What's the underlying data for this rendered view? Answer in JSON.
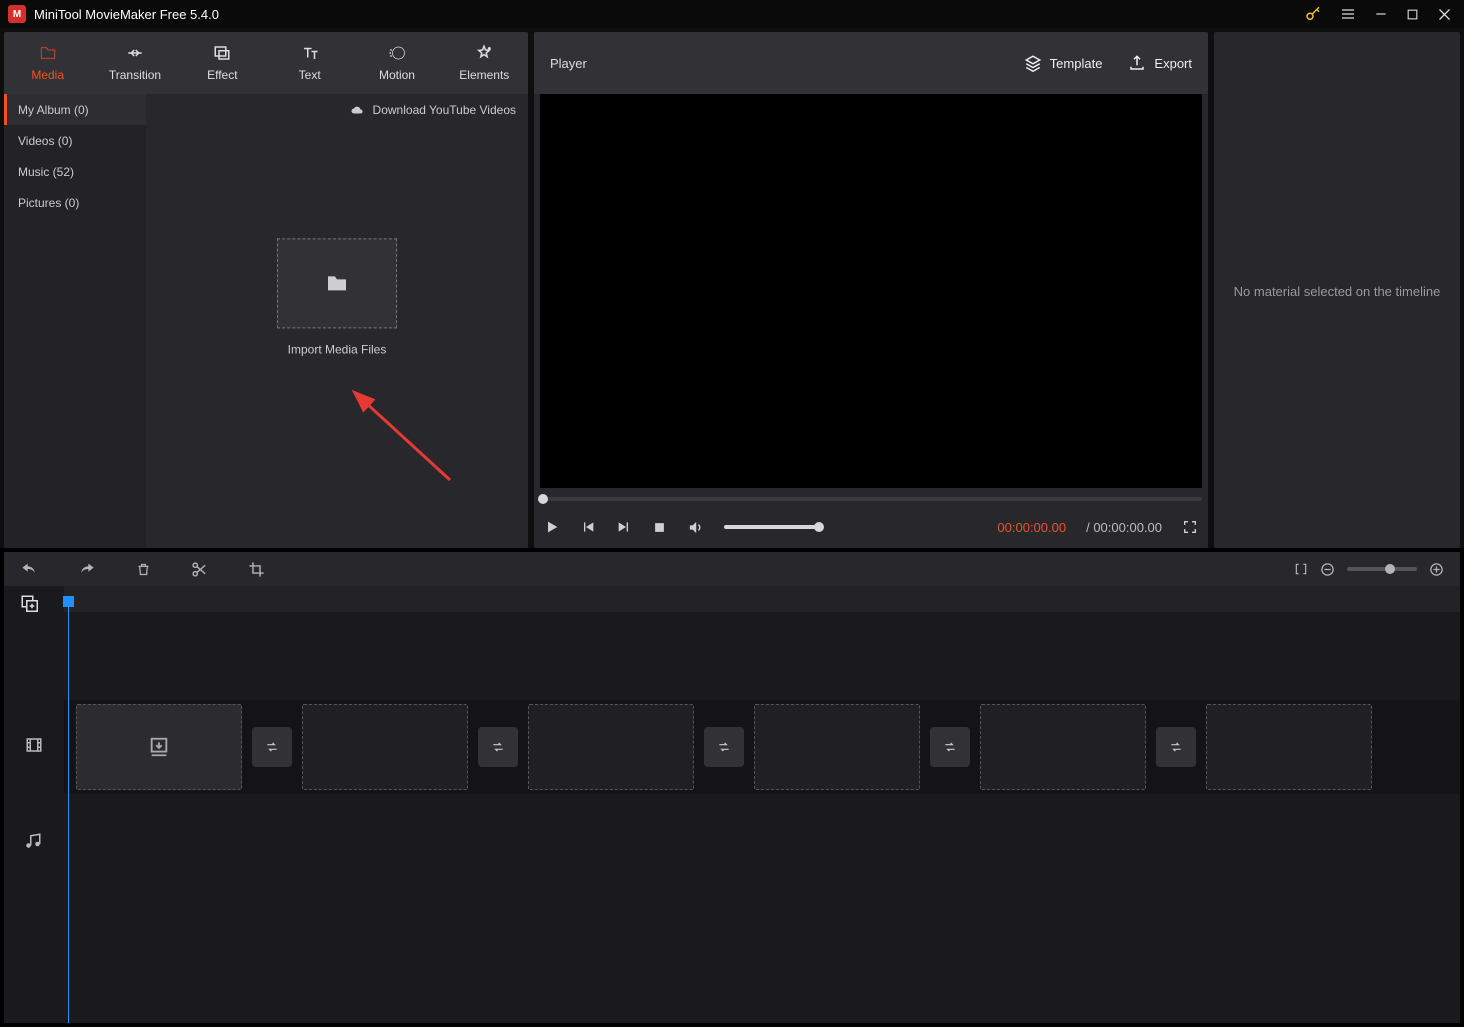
{
  "title": "MiniTool MovieMaker Free 5.4.0",
  "mainTabs": {
    "media": "Media",
    "transition": "Transition",
    "effect": "Effect",
    "text": "Text",
    "motion": "Motion",
    "elements": "Elements"
  },
  "sidebar": {
    "album": "My Album (0)",
    "videos": "Videos (0)",
    "music": "Music (52)",
    "pictures": "Pictures (0)"
  },
  "downloadYT": "Download YouTube Videos",
  "importLabel": "Import Media Files",
  "player": {
    "title": "Player",
    "template": "Template",
    "export": "Export",
    "current": "00:00:00.00",
    "total": "/ 00:00:00.00"
  },
  "propsMessage": "No material selected on the timeline"
}
